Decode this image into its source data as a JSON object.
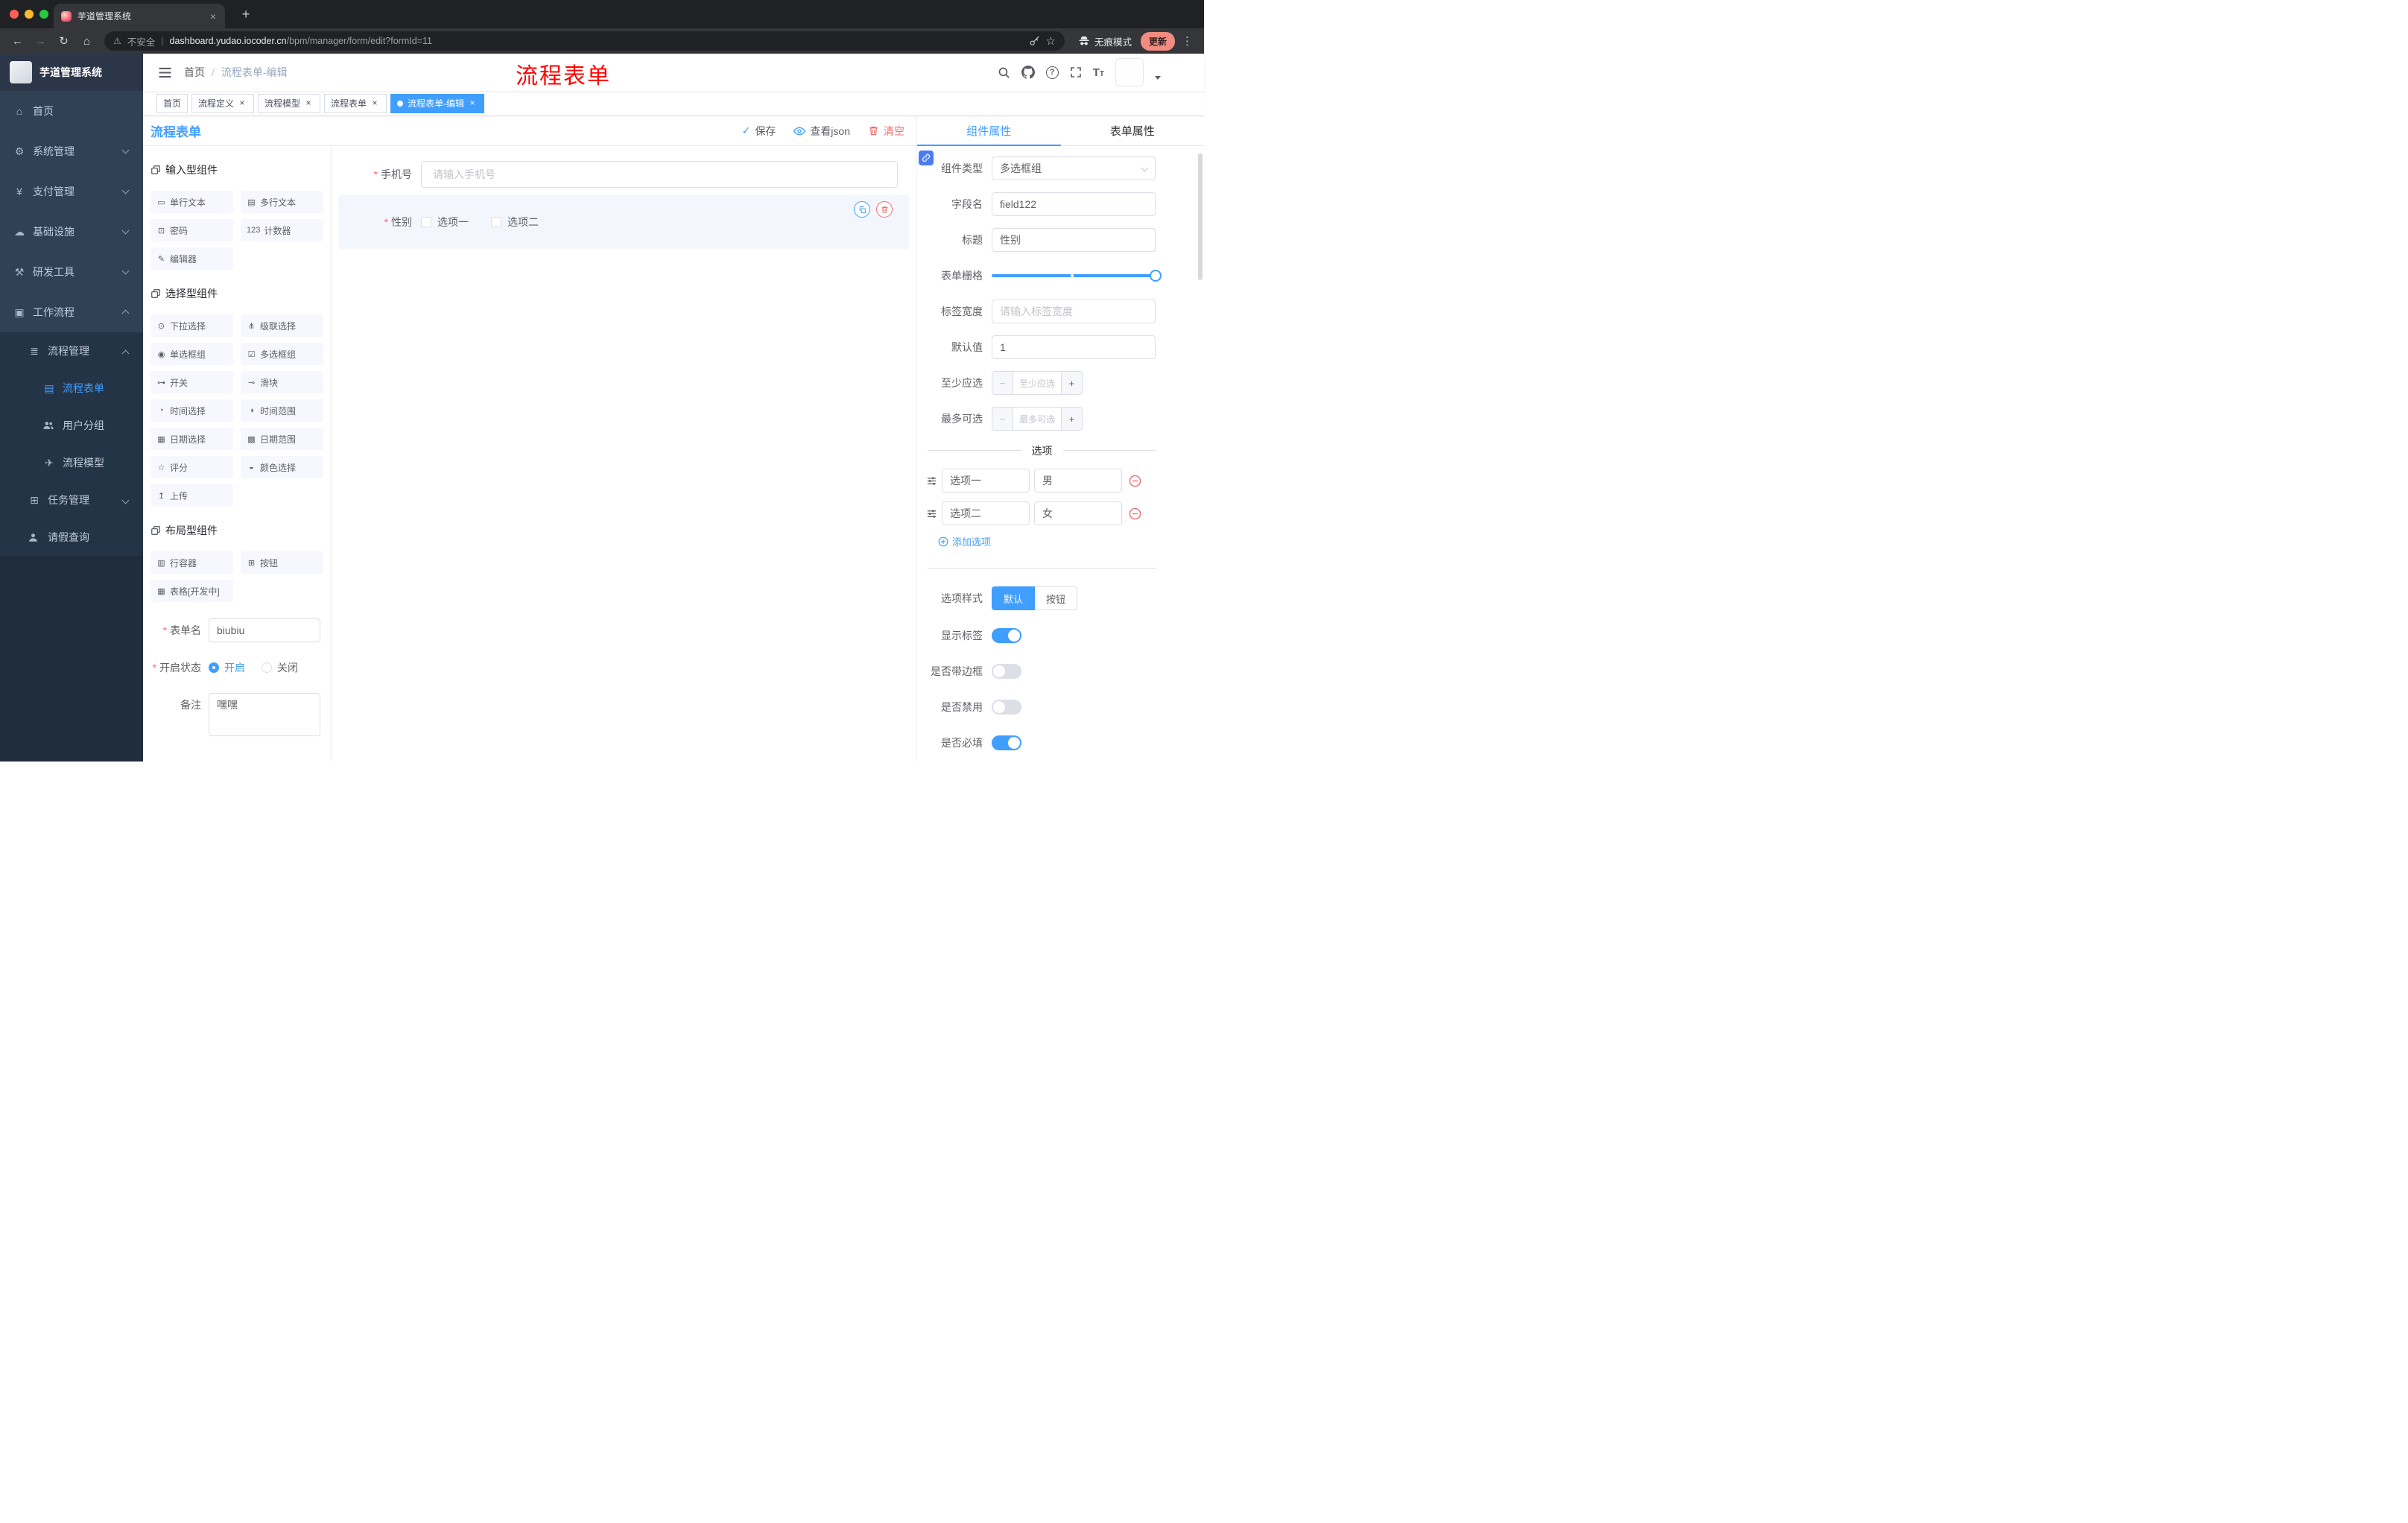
{
  "colors": {
    "accent": "#409eff",
    "danger": "#f56c6c",
    "annotation_red": "#ff0000",
    "sidebar_bg": "#304156",
    "active_tag_bg": "#409eff"
  },
  "browser": {
    "tab_title": "芋道管理系统",
    "security_label": "不安全",
    "url_domain": "dashboard.yudao.iocoder.cn",
    "url_path": "/bpm/manager/form/edit?formId=11",
    "incognito_label": "无痕模式",
    "update_label": "更新"
  },
  "sidebar": {
    "title": "芋道管理系统",
    "menu": [
      {
        "label": "首页",
        "icon": "⌂"
      },
      {
        "label": "系统管理",
        "icon": "⚙"
      },
      {
        "label": "支付管理",
        "icon": "¥"
      },
      {
        "label": "基础设施",
        "icon": "☁"
      },
      {
        "label": "研发工具",
        "icon": "⚒"
      },
      {
        "label": "工作流程",
        "icon": "▣"
      },
      {
        "label": "流程管理",
        "icon": "≣"
      },
      {
        "label": "流程表单",
        "icon": "▤"
      },
      {
        "label": "用户分组",
        "icon": ""
      },
      {
        "label": "流程模型",
        "icon": "✈"
      },
      {
        "label": "任务管理",
        "icon": "⊞"
      },
      {
        "label": "请假查询",
        "icon": ""
      }
    ]
  },
  "navbar": {
    "breadcrumb": [
      "首页",
      "流程表单-编辑"
    ],
    "separator": "/",
    "annotation": "流程表单"
  },
  "tags": [
    {
      "label": "首页"
    },
    {
      "label": "流程定义"
    },
    {
      "label": "流程模型"
    },
    {
      "label": "流程表单"
    },
    {
      "label": "流程表单-编辑"
    }
  ],
  "editor": {
    "title": "流程表单",
    "actions": {
      "save": "保存",
      "view_json": "查看json",
      "clear": "清空"
    },
    "palette": {
      "groups": [
        {
          "title": "输入型组件",
          "items": [
            {
              "label": "单行文本",
              "icon": "▭"
            },
            {
              "label": "多行文本",
              "icon": "▤"
            },
            {
              "label": "密码",
              "icon": "⊡"
            },
            {
              "label": "计数器",
              "icon": "123"
            },
            {
              "label": "编辑器",
              "icon": "✎"
            }
          ]
        },
        {
          "title": "选择型组件",
          "items": [
            {
              "label": "下拉选择",
              "icon": "⊙"
            },
            {
              "label": "级联选择",
              "icon": "⋔"
            },
            {
              "label": "单选框组",
              "icon": "◉"
            },
            {
              "label": "多选框组",
              "icon": "☑"
            },
            {
              "label": "开关",
              "icon": "⊶"
            },
            {
              "label": "滑块",
              "icon": "⊸"
            },
            {
              "label": "时间选择",
              "icon": "◔"
            },
            {
              "label": "时间范围",
              "icon": "◑"
            },
            {
              "label": "日期选择",
              "icon": "▦"
            },
            {
              "label": "日期范围",
              "icon": "▩"
            },
            {
              "label": "评分",
              "icon": "☆"
            },
            {
              "label": "颜色选择",
              "icon": "◒"
            },
            {
              "label": "上传",
              "icon": "↥"
            }
          ]
        },
        {
          "title": "布局型组件",
          "items": [
            {
              "label": "行容器",
              "icon": "▥"
            },
            {
              "label": "按钮",
              "icon": "⊞"
            },
            {
              "label": "表格[开发中]",
              "icon": "▦"
            }
          ]
        }
      ]
    },
    "meta": {
      "name_label": "表单名",
      "name_value": "biubiu",
      "state_label": "开启状态",
      "state_on": "开启",
      "state_off": "关闭",
      "remark_label": "备注",
      "remark_value": "嘿嘿"
    },
    "canvas": {
      "phone_label": "手机号",
      "phone_placeholder": "请输入手机号",
      "gender_label": "性别",
      "gender_options": [
        "选项一",
        "选项二"
      ]
    },
    "props": {
      "tab_component": "组件属性",
      "tab_form": "表单属性",
      "component_type_label": "组件类型",
      "component_type_value": "多选框组",
      "field_name_label": "字段名",
      "field_name_value": "field122",
      "title_label": "标题",
      "title_value": "性别",
      "grid_label": "表单栅格",
      "label_width_label": "标签宽度",
      "label_width_placeholder": "请输入标签宽度",
      "default_label": "默认值",
      "default_value": "1",
      "min_label": "至少应选",
      "min_placeholder": "至少应选",
      "max_label": "最多可选",
      "max_placeholder": "最多可选",
      "options_divider": "选项",
      "options": [
        {
          "label": "选项一",
          "value": "男"
        },
        {
          "label": "选项二",
          "value": "女"
        }
      ],
      "add_option": "添加选项",
      "option_style_label": "选项样式",
      "style_default": "默认",
      "style_button": "按钮",
      "show_label_label": "显示标签",
      "border_label": "是否带边框",
      "disabled_label": "是否禁用",
      "required_label": "是否必填"
    }
  }
}
